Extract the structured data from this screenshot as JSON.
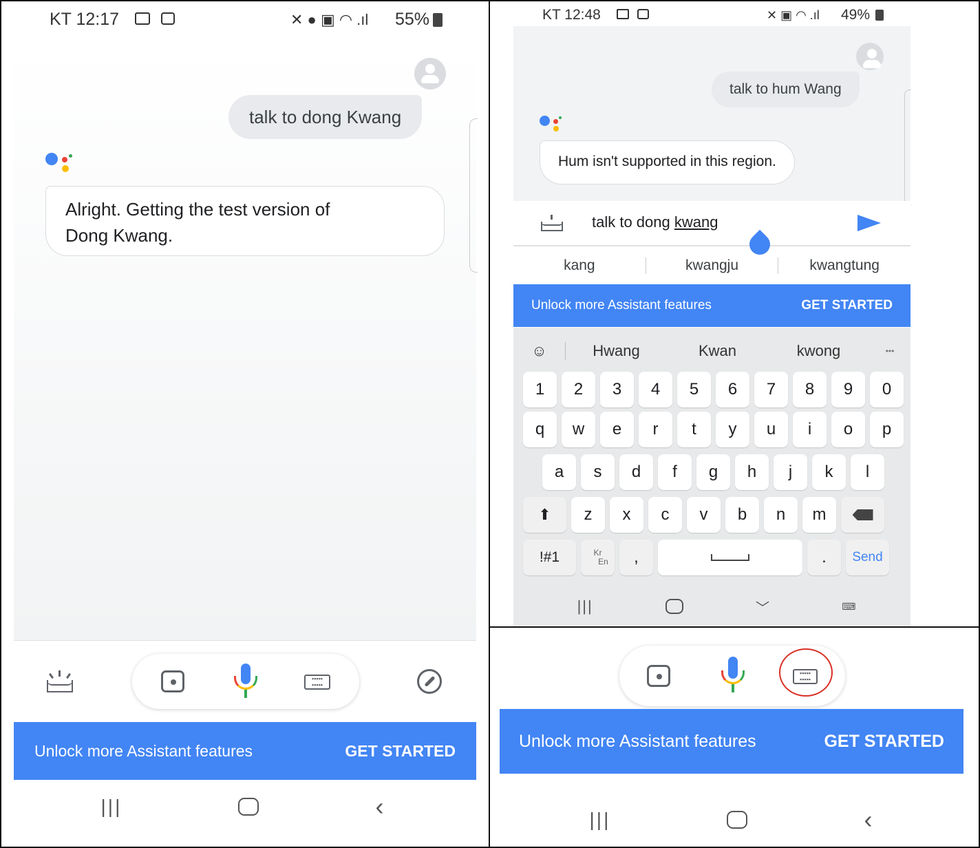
{
  "left": {
    "status": {
      "time": "KT 12:17",
      "right": "55%"
    },
    "user_query": "talk to dong Kwang",
    "assistant_reply_line1": "Alright. Getting the test version of",
    "assistant_reply_line2": "Dong Kwang.",
    "banner": {
      "text": "Unlock more Assistant features",
      "action": "GET STARTED"
    }
  },
  "right_top": {
    "status": {
      "time": "KT 12:48",
      "right": "49%"
    },
    "user_query": "talk to hum Wang",
    "assistant_reply": "Hum isn't supported in this region.",
    "input_prefix": "talk to dong ",
    "input_underlined": "kwang",
    "suggestions": [
      "kang",
      "kwangju",
      "kwangtung"
    ],
    "banner": {
      "text": "Unlock more Assistant features",
      "action": "GET STARTED"
    },
    "keyboard": {
      "predictions": [
        "Hwang",
        "Kwan",
        "kwong"
      ],
      "more": "•••",
      "row_numbers": [
        "1",
        "2",
        "3",
        "4",
        "5",
        "6",
        "7",
        "8",
        "9",
        "0"
      ],
      "row1": [
        "q",
        "w",
        "e",
        "r",
        "t",
        "y",
        "u",
        "i",
        "o",
        "p"
      ],
      "row2": [
        "a",
        "s",
        "d",
        "f",
        "g",
        "h",
        "j",
        "k",
        "l"
      ],
      "row3": [
        "z",
        "x",
        "c",
        "v",
        "b",
        "n",
        "m"
      ],
      "symbols_key": "!#1",
      "lang_top": "Kr",
      "lang_bottom": "En",
      "comma": ",",
      "period": ".",
      "send": "Send"
    }
  },
  "right_bottom": {
    "banner": {
      "text": "Unlock more Assistant features",
      "action": "GET STARTED"
    }
  },
  "colors": {
    "accent": "#4285f4",
    "google_red": "#ea4335",
    "google_yellow": "#fbbc04",
    "google_green": "#34a853",
    "highlight_circle": "#d93025"
  }
}
